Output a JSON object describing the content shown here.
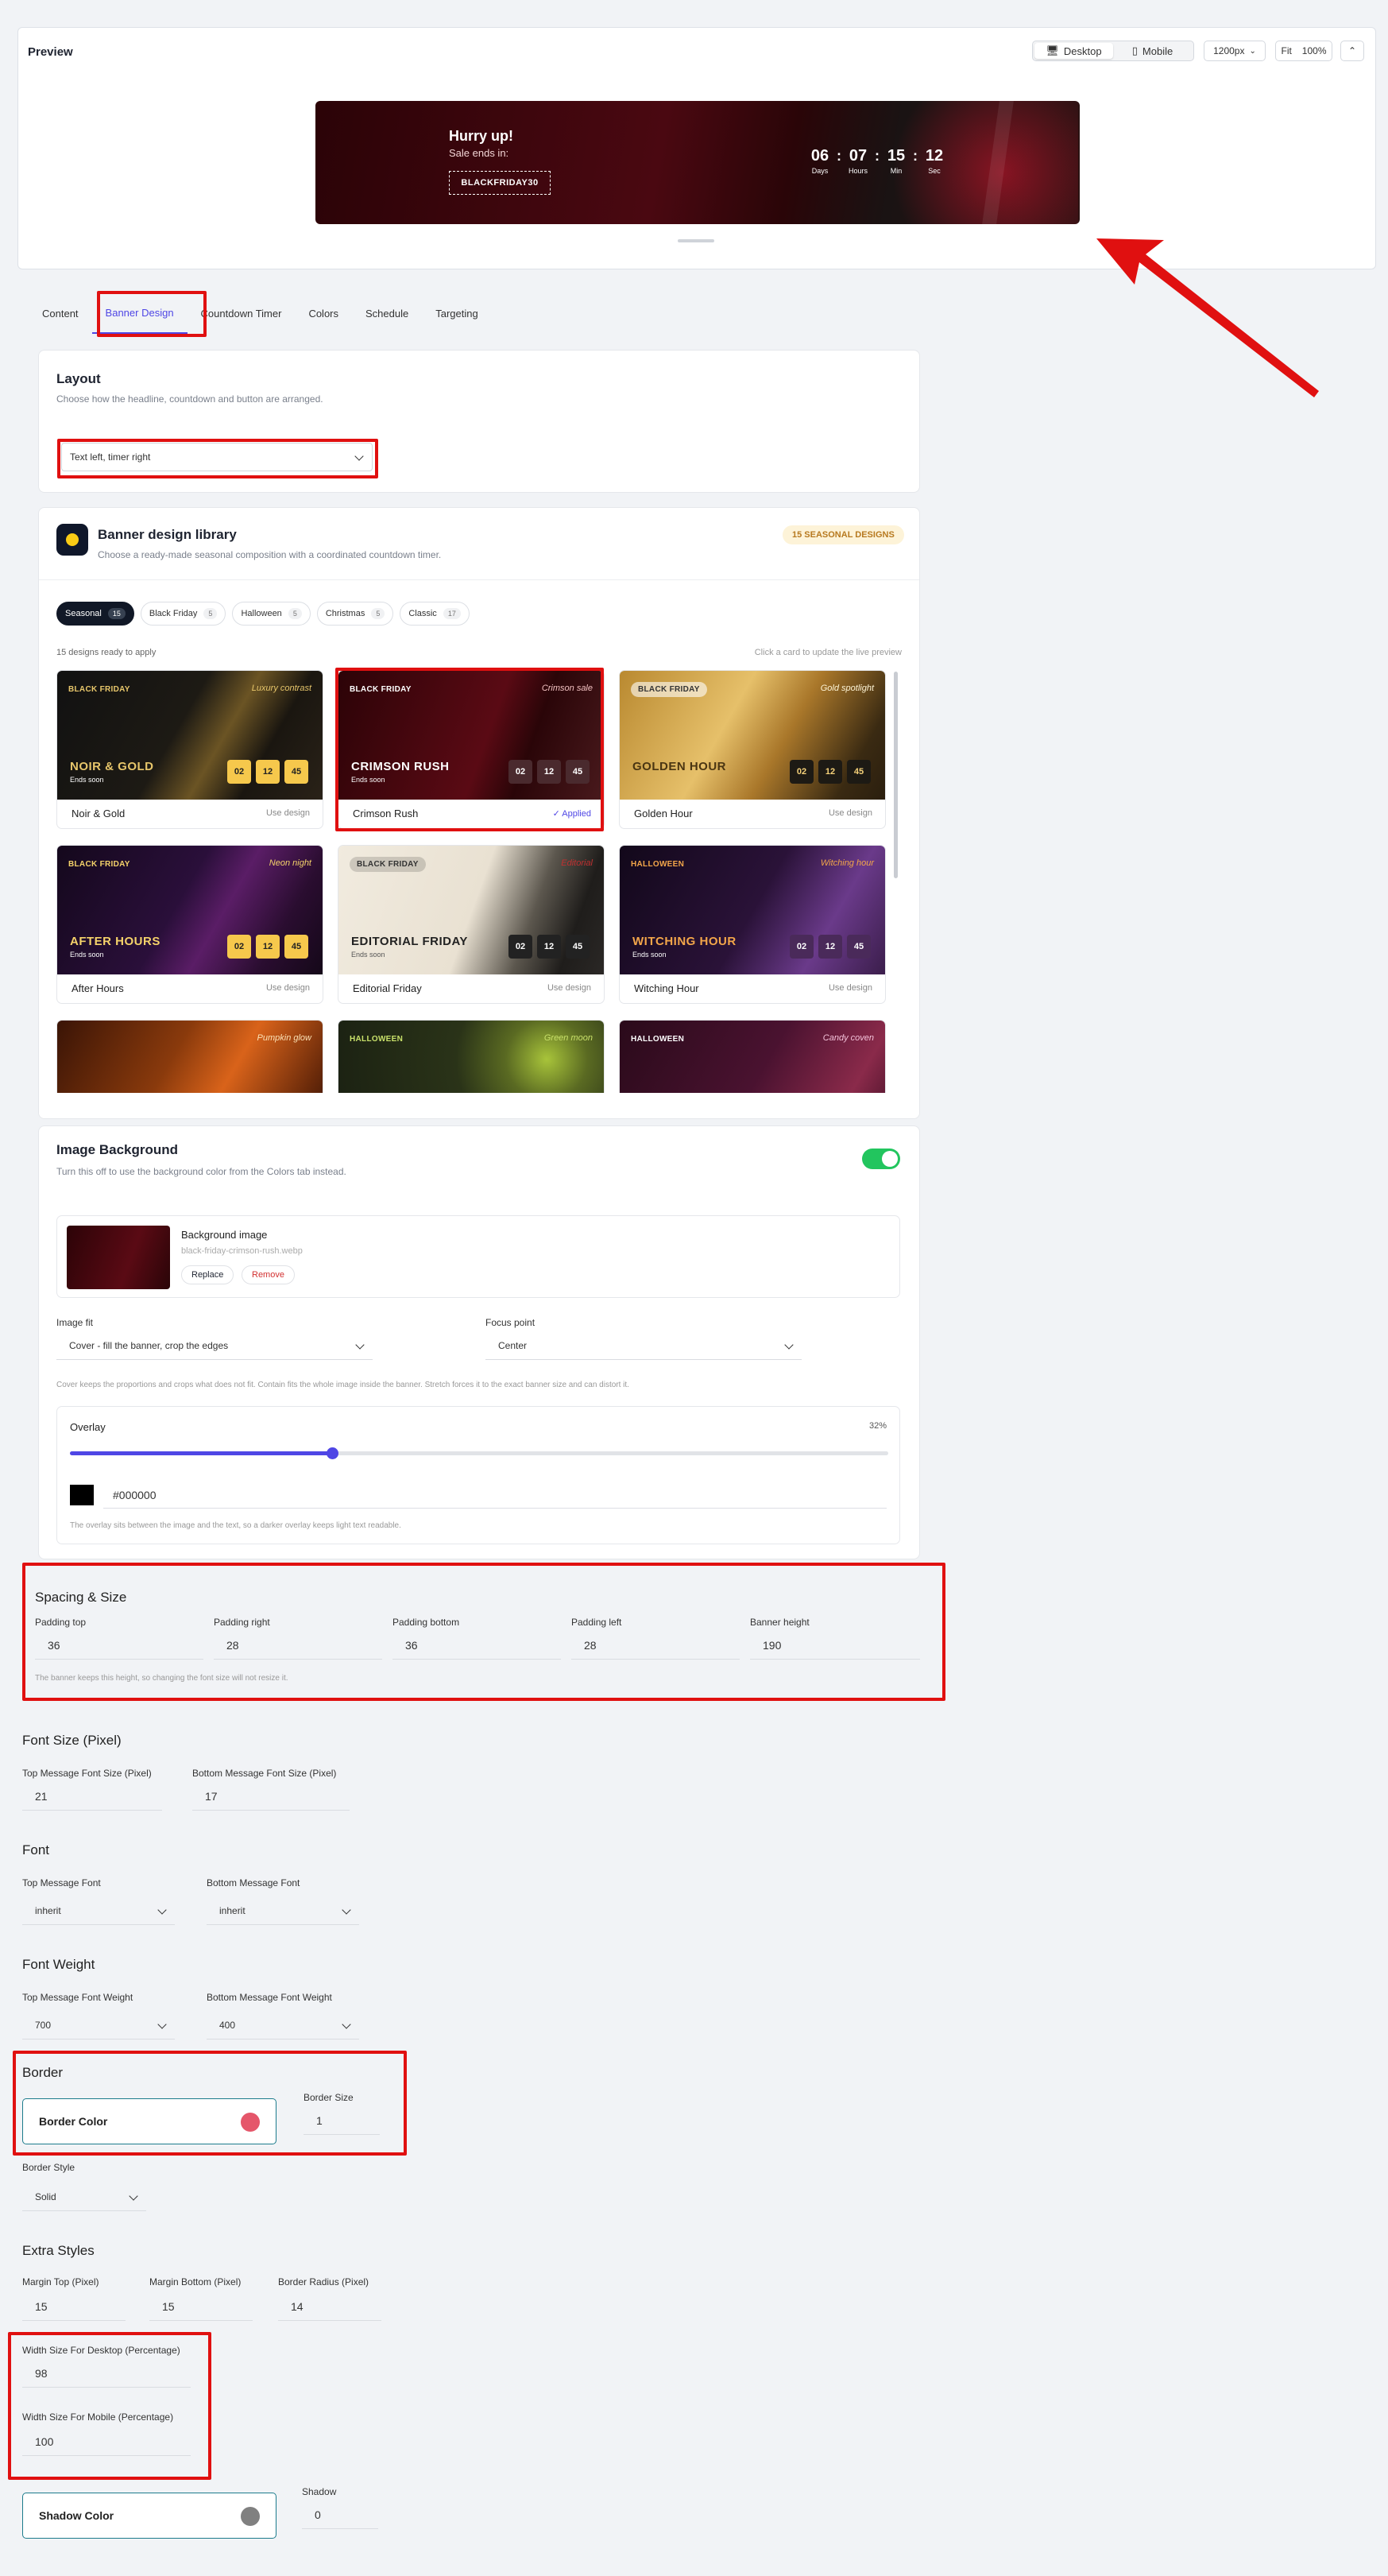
{
  "preview": {
    "title": "Preview",
    "device_desktop": "Desktop",
    "device_mobile": "Mobile",
    "width_select": "1200px",
    "fit": "Fit",
    "zoom": "100%",
    "banner": {
      "headline": "Hurry up!",
      "subline": "Sale ends in:",
      "code": "BLACKFRIDAY30",
      "timer": [
        {
          "value": "06",
          "label": "Days"
        },
        {
          "value": "07",
          "label": "Hours"
        },
        {
          "value": "15",
          "label": "Min"
        },
        {
          "value": "12",
          "label": "Sec"
        }
      ]
    }
  },
  "tabs": [
    "Content",
    "Banner Design",
    "Countdown Timer",
    "Colors",
    "Schedule",
    "Targeting"
  ],
  "layout": {
    "title": "Layout",
    "desc": "Choose how the headline, countdown and button are arranged.",
    "value": "Text left, timer right"
  },
  "library": {
    "title": "Banner design library",
    "desc": "Choose a ready-made seasonal composition with a coordinated countdown timer.",
    "badge": "15 SEASONAL DESIGNS",
    "filters": [
      {
        "label": "Seasonal",
        "count": "15"
      },
      {
        "label": "Black Friday",
        "count": "5"
      },
      {
        "label": "Halloween",
        "count": "5"
      },
      {
        "label": "Christmas",
        "count": "5"
      },
      {
        "label": "Classic",
        "count": "17"
      }
    ],
    "ready": "15 designs ready to apply",
    "hint": "Click a card to update the live preview",
    "use_label": "Use design",
    "applied_label": "✓ Applied",
    "ends_soon": "Ends soon",
    "cards": [
      {
        "name": "Noir & Gold",
        "tag": "BLACK FRIDAY",
        "corner": "Luxury contrast",
        "big": "NOIR & GOLD",
        "cd": [
          "02",
          "12",
          "45"
        ]
      },
      {
        "name": "Crimson Rush",
        "tag": "BLACK FRIDAY",
        "corner": "Crimson sale",
        "big": "CRIMSON RUSH",
        "cd": [
          "02",
          "12",
          "45"
        ]
      },
      {
        "name": "Golden Hour",
        "tag": "BLACK FRIDAY",
        "corner": "Gold spotlight",
        "big": "GOLDEN HOUR",
        "cd": [
          "02",
          "12",
          "45"
        ]
      },
      {
        "name": "After Hours",
        "tag": "BLACK FRIDAY",
        "corner": "Neon night",
        "big": "AFTER HOURS",
        "cd": [
          "02",
          "12",
          "45"
        ]
      },
      {
        "name": "Editorial Friday",
        "tag": "BLACK FRIDAY",
        "corner": "Editorial",
        "big": "EDITORIAL FRIDAY",
        "cd": [
          "02",
          "12",
          "45"
        ]
      },
      {
        "name": "Witching Hour",
        "tag": "HALLOWEEN",
        "corner": "Witching hour",
        "big": "WITCHING HOUR",
        "cd": [
          "02",
          "12",
          "45"
        ]
      },
      {
        "tag": "",
        "corner": "Pumpkin glow"
      },
      {
        "tag": "HALLOWEEN",
        "corner": "Green moon"
      },
      {
        "tag": "HALLOWEEN",
        "corner": "Candy coven"
      }
    ]
  },
  "image_bg": {
    "title": "Image Background",
    "desc": "Turn this off to use the background color from the Colors tab instead.",
    "file_label": "Background image",
    "file_name": "black-friday-crimson-rush.webp",
    "replace": "Replace",
    "remove": "Remove",
    "fit_label": "Image fit",
    "fit_value": "Cover - fill the banner, crop the edges",
    "focus_label": "Focus point",
    "focus_value": "Center",
    "fit_help": "Cover keeps the proportions and crops what does not fit. Contain fits the whole image inside the banner. Stretch forces it to the exact banner size and can distort it.",
    "overlay_label": "Overlay",
    "overlay_value": "32%",
    "overlay_fraction": 0.32,
    "overlay_color": "#000000",
    "overlay_help": "The overlay sits between the image and the text, so a darker overlay keeps light text readable."
  },
  "spacing": {
    "title": "Spacing & Size",
    "fields": [
      {
        "label": "Padding top",
        "value": "36"
      },
      {
        "label": "Padding right",
        "value": "28"
      },
      {
        "label": "Padding bottom",
        "value": "36"
      },
      {
        "label": "Padding left",
        "value": "28"
      },
      {
        "label": "Banner height",
        "value": "190"
      }
    ],
    "help": "The banner keeps this height, so changing the font size will not resize it."
  },
  "font_size": {
    "title": "Font Size (Pixel)",
    "top_label": "Top Message Font Size (Pixel)",
    "top_value": "21",
    "bottom_label": "Bottom Message Font Size (Pixel)",
    "bottom_value": "17"
  },
  "font": {
    "title": "Font",
    "top_label": "Top Message Font",
    "top_value": "inherit",
    "bottom_label": "Bottom Message Font",
    "bottom_value": "inherit"
  },
  "font_weight": {
    "title": "Font Weight",
    "top_label": "Top Message Font Weight",
    "top_value": "700",
    "bottom_label": "Bottom Message Font Weight",
    "bottom_value": "400"
  },
  "border": {
    "title": "Border",
    "color_label": "Border Color",
    "color": "#e5566a",
    "size_label": "Border Size",
    "size_value": "1",
    "style_label": "Border Style",
    "style_value": "Solid"
  },
  "extra": {
    "title": "Extra Styles",
    "mt_label": "Margin Top (Pixel)",
    "mt_value": "15",
    "mb_label": "Margin Bottom (Pixel)",
    "mb_value": "15",
    "br_label": "Border Radius (Pixel)",
    "br_value": "14",
    "wd_label": "Width Size For Desktop (Percentage)",
    "wd_value": "98",
    "wm_label": "Width Size For Mobile (Percentage)",
    "wm_value": "100",
    "shadow_color_label": "Shadow Color",
    "shadow_color": "#808080",
    "shadow_label": "Shadow",
    "shadow_value": "0"
  },
  "colors": {
    "accent": "#4f46e5",
    "toggle": "#22c55e",
    "annotation": "#e01010"
  }
}
